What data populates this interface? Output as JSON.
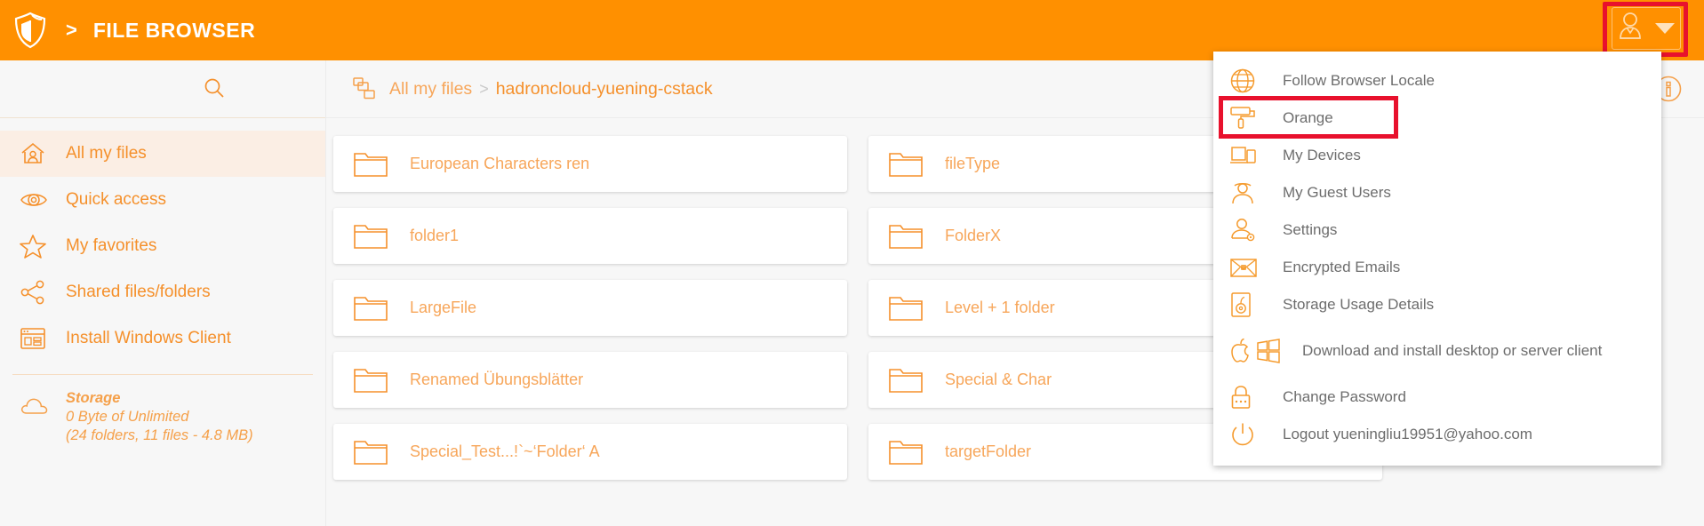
{
  "header": {
    "separator": ">",
    "title": "FILE BROWSER",
    "logo_icon": "shield-logo-icon",
    "avatar_icon": "user-avatar-icon",
    "caret_icon": "chevron-down-icon",
    "bg_color": "#FF9000"
  },
  "sidebar": {
    "search": {
      "icon": "search-icon",
      "placeholder": ""
    },
    "items": [
      {
        "label": "All my files",
        "icon": "home-user-icon",
        "active": true
      },
      {
        "label": "Quick access",
        "icon": "eye-icon",
        "active": false
      },
      {
        "label": "My favorites",
        "icon": "star-icon",
        "active": false
      },
      {
        "label": "Shared files/folders",
        "icon": "share-nodes-icon",
        "active": false
      },
      {
        "label": "Install Windows Client",
        "icon": "window-app-icon",
        "active": false
      }
    ],
    "storage": {
      "icon": "cloud-icon",
      "title": "Storage",
      "usage": "0 Byte of Unlimited",
      "details": "(24 folders, 11 files - 4.8 MB)"
    }
  },
  "content": {
    "breadcrumb": {
      "icon": "folder-tree-icon",
      "root": "All my files",
      "separator": ">",
      "current": "hadroncloud-yuening-cstack"
    },
    "info_icon": "info-circle-icon",
    "folders": [
      {
        "name": "European Characters ren",
        "icon": "folder-icon"
      },
      {
        "name": "fileType",
        "icon": "folder-icon"
      },
      {
        "name": "folder1",
        "icon": "folder-icon"
      },
      {
        "name": "FolderX",
        "icon": "folder-icon"
      },
      {
        "name": "LargeFile",
        "icon": "folder-icon"
      },
      {
        "name": "Level + 1 folder",
        "icon": "folder-icon"
      },
      {
        "name": "Renamed Übungsblätter",
        "icon": "folder-icon"
      },
      {
        "name": "Special & Char",
        "icon": "folder-icon"
      },
      {
        "name": "Special_Test...!`~‘Folder‘ A",
        "icon": "folder-icon"
      },
      {
        "name": "targetFolder",
        "icon": "folder-icon"
      }
    ]
  },
  "user_menu": {
    "items": [
      {
        "label": "Follow Browser Locale",
        "icon": "globe-icon",
        "highlighted": false
      },
      {
        "label": "Orange",
        "icon": "paint-roller-icon",
        "highlighted": true
      },
      {
        "label": "My Devices",
        "icon": "devices-icon",
        "highlighted": false
      },
      {
        "label": "My Guest Users",
        "icon": "guest-user-icon",
        "highlighted": false
      },
      {
        "label": "Settings",
        "icon": "user-settings-icon",
        "highlighted": false
      },
      {
        "label": "Encrypted Emails",
        "icon": "encrypted-mail-icon",
        "highlighted": false
      },
      {
        "label": "Storage Usage Details",
        "icon": "hard-disk-icon",
        "highlighted": false
      },
      {
        "label": "Download and install desktop or server client",
        "icon": "apple-windows-icon",
        "highlighted": false
      },
      {
        "label": "Change Password",
        "icon": "padlock-icon",
        "highlighted": false
      },
      {
        "label": "Logout yueningliu19951@yahoo.com",
        "icon": "power-icon",
        "highlighted": false
      }
    ]
  },
  "colors": {
    "accent": "#FF9000",
    "accent_light": "#F7A65A",
    "highlight_box": "#E8112D",
    "panel_bg": "#F7F7F7"
  }
}
